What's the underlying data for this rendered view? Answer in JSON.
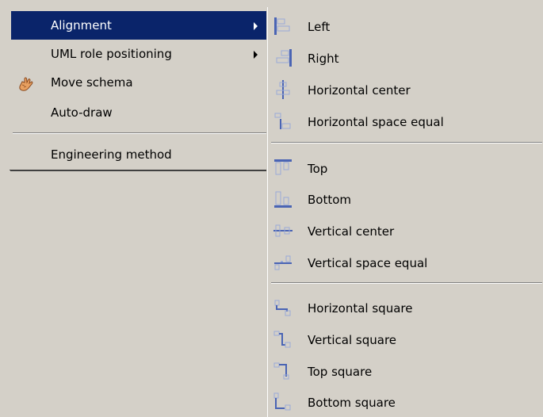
{
  "menu": {
    "items": [
      {
        "label": "Alignment",
        "has_submenu": true,
        "highlighted": true
      },
      {
        "label": "UML role positioning",
        "has_submenu": true
      },
      {
        "label": "Move schema",
        "icon": "hand-icon"
      },
      {
        "label": "Auto-draw"
      },
      {
        "label": "Engineering method"
      }
    ]
  },
  "submenu": {
    "groups": [
      [
        {
          "label": "Left",
          "icon": "align-left-icon"
        },
        {
          "label": "Right",
          "icon": "align-right-icon"
        },
        {
          "label": "Horizontal center",
          "icon": "align-horizontal-center-icon"
        },
        {
          "label": "Horizontal space equal",
          "icon": "horizontal-space-equal-icon"
        }
      ],
      [
        {
          "label": "Top",
          "icon": "align-top-icon"
        },
        {
          "label": "Bottom",
          "icon": "align-bottom-icon"
        },
        {
          "label": "Vertical center",
          "icon": "align-vertical-center-icon"
        },
        {
          "label": "Vertical space equal",
          "icon": "vertical-space-equal-icon"
        }
      ],
      [
        {
          "label": "Horizontal square",
          "icon": "horizontal-square-icon"
        },
        {
          "label": "Vertical square",
          "icon": "vertical-square-icon"
        },
        {
          "label": "Top square",
          "icon": "top-square-icon"
        },
        {
          "label": "Bottom square",
          "icon": "bottom-square-icon"
        }
      ]
    ]
  },
  "colors": {
    "menu_bg": "#d4d0c8",
    "highlight_bg": "#0a246a",
    "highlight_text": "#ffffff",
    "icon_blue": "#4a64b4",
    "icon_light": "#9aaad8"
  }
}
